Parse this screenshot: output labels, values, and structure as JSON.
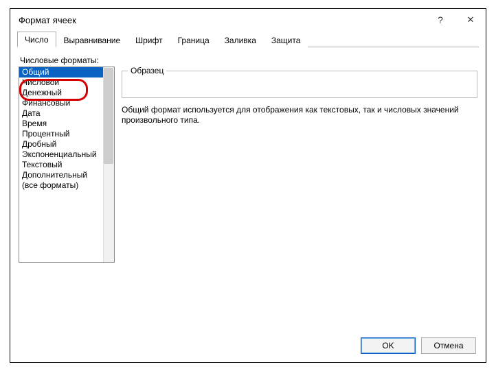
{
  "window": {
    "title": "Формат ячеек",
    "help_symbol": "?",
    "close_symbol": "✕"
  },
  "tabs": [
    {
      "label": "Число"
    },
    {
      "label": "Выравнивание"
    },
    {
      "label": "Шрифт"
    },
    {
      "label": "Граница"
    },
    {
      "label": "Заливка"
    },
    {
      "label": "Защита"
    }
  ],
  "formats_label": "Числовые форматы:",
  "formats": [
    "Общий",
    "Числовой",
    "Денежный",
    "Финансовый",
    "Дата",
    "Время",
    "Процентный",
    "Дробный",
    "Экспоненциальный",
    "Текстовый",
    "Дополнительный",
    "(все форматы)"
  ],
  "sample_label": "Образец",
  "description": "Общий формат используется для отображения как текстовых, так и числовых значений произвольного типа.",
  "buttons": {
    "ok": "OK",
    "cancel": "Отмена"
  }
}
